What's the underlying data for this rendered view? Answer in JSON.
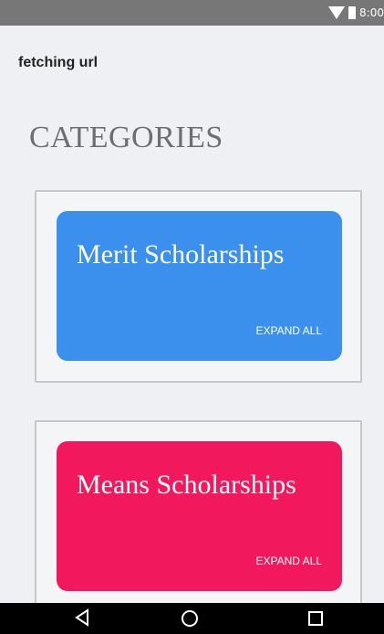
{
  "status_bar": {
    "time": "8:00",
    "icons": [
      "wifi-icon",
      "battery-icon"
    ]
  },
  "page": {
    "url_status": "fetching url",
    "section_title": "CATEGORIES"
  },
  "categories": [
    {
      "title": "Merit Scholarships",
      "action_label": "EXPAND ALL",
      "color": "#3a90ec"
    },
    {
      "title": "Means Scholarships",
      "action_label": "EXPAND ALL",
      "color": "#f2185e"
    }
  ],
  "nav_bar": {
    "icons": [
      "back-icon",
      "home-icon",
      "recent-apps-icon"
    ]
  },
  "colors": {
    "status_bar": "#777777",
    "background": "#eef0f3",
    "title_text": "#6b6e72",
    "nav_bar": "#000000"
  }
}
